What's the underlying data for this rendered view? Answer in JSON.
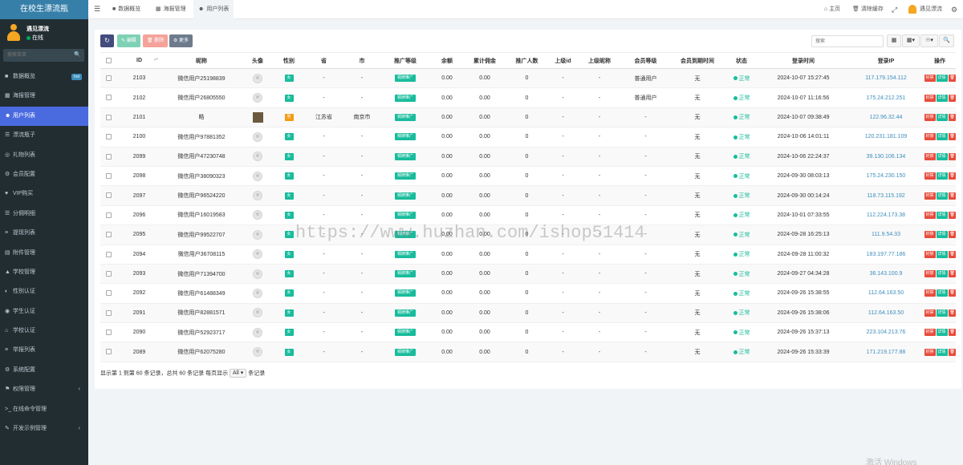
{
  "app": {
    "title": "在校生漂流瓶"
  },
  "user": {
    "name": "遇见漂流",
    "status": "在线"
  },
  "search": {
    "placeholder": "搜索菜单"
  },
  "menu": [
    {
      "label": "数据概览",
      "icon": "dashboard-icon",
      "badge": "hot"
    },
    {
      "label": "海报管理",
      "icon": "poster-icon"
    },
    {
      "label": "用户列表",
      "icon": "users-icon",
      "active": true
    },
    {
      "label": "漂流瓶子",
      "icon": "list-icon"
    },
    {
      "label": "礼物列表",
      "icon": "gift-icon"
    },
    {
      "label": "会员配置",
      "icon": "gear-icon"
    },
    {
      "label": "VIP购买",
      "icon": "vip-icon"
    },
    {
      "label": "分佣明细",
      "icon": "commission-icon"
    },
    {
      "label": "提现列表",
      "icon": "withdraw-icon"
    },
    {
      "label": "附件管理",
      "icon": "attachment-icon"
    },
    {
      "label": "学校管理",
      "icon": "school-icon"
    },
    {
      "label": "性别认证",
      "icon": "gender-icon"
    },
    {
      "label": "学生认证",
      "icon": "student-icon"
    },
    {
      "label": "学校认证",
      "icon": "bank-icon"
    },
    {
      "label": "举报列表",
      "icon": "report-icon"
    },
    {
      "label": "系统配置",
      "icon": "system-icon"
    },
    {
      "label": "权限管理",
      "icon": "permission-icon",
      "expandable": true
    },
    {
      "label": "在线命令管理",
      "icon": "terminal-icon"
    },
    {
      "label": "开发示例管理",
      "icon": "dev-icon",
      "expandable": true
    }
  ],
  "tabs": [
    {
      "label": "数据概览",
      "icon": "dashboard-icon"
    },
    {
      "label": "海报管理",
      "icon": "poster-icon"
    },
    {
      "label": "用户列表",
      "icon": "users-icon",
      "active": true
    }
  ],
  "topbar": {
    "home": "主页",
    "clear_cache": "清除缓存",
    "username": "遇见漂流"
  },
  "toolbar": {
    "edit": "编辑",
    "delete": "删除",
    "more": "更多",
    "search_placeholder": "搜索"
  },
  "table": {
    "columns": [
      "ID",
      "昵称",
      "头像",
      "性别",
      "省",
      "市",
      "推广等级",
      "余额",
      "累计佣金",
      "推广人数",
      "上级id",
      "上级昵称",
      "会员等级",
      "会员到期时间",
      "状态",
      "登录时间",
      "登录IP",
      "操作"
    ],
    "rows": [
      {
        "id": "2103",
        "nickname": "微信用户25198839",
        "avatar": "default",
        "gender": "女",
        "province": "-",
        "city": "-",
        "promo": "铜牌推广",
        "balance": "0.00",
        "commission": "0.00",
        "invites": "0",
        "parent_id": "-",
        "parent_name": "-",
        "member_level": "普通用户",
        "expire": "无",
        "status": "正常",
        "login_time": "2024-10-07 15:27:45",
        "ip": "117.179.154.112"
      },
      {
        "id": "2102",
        "nickname": "微信用户26805550",
        "avatar": "default",
        "gender": "女",
        "province": "-",
        "city": "-",
        "promo": "铜牌推广",
        "balance": "0.00",
        "commission": "0.00",
        "invites": "0",
        "parent_id": "-",
        "parent_name": "-",
        "member_level": "普通用户",
        "expire": "无",
        "status": "正常",
        "login_time": "2024-10-07 11:16:56",
        "ip": "175.24.212.251"
      },
      {
        "id": "2101",
        "nickname": "皓",
        "avatar": "photo",
        "gender": "男",
        "province": "江苏省",
        "city": "南京市",
        "promo": "铜牌推广",
        "balance": "0.00",
        "commission": "0.00",
        "invites": "0",
        "parent_id": "-",
        "parent_name": "-",
        "member_level": "-",
        "expire": "无",
        "status": "正常",
        "login_time": "2024-10-07 09:38:49",
        "ip": "122.96.32.44"
      },
      {
        "id": "2100",
        "nickname": "微信用户97881352",
        "avatar": "default",
        "gender": "女",
        "province": "-",
        "city": "-",
        "promo": "铜牌推广",
        "balance": "0.00",
        "commission": "0.00",
        "invites": "0",
        "parent_id": "-",
        "parent_name": "-",
        "member_level": "-",
        "expire": "无",
        "status": "正常",
        "login_time": "2024-10-06 14:01:11",
        "ip": "120.231.181.109"
      },
      {
        "id": "2099",
        "nickname": "微信用户47230748",
        "avatar": "default",
        "gender": "女",
        "province": "-",
        "city": "-",
        "promo": "铜牌推广",
        "balance": "0.00",
        "commission": "0.00",
        "invites": "0",
        "parent_id": "-",
        "parent_name": "-",
        "member_level": "-",
        "expire": "无",
        "status": "正常",
        "login_time": "2024-10-06 22:24:37",
        "ip": "39.130.106.134"
      },
      {
        "id": "2098",
        "nickname": "微信用户38090323",
        "avatar": "default",
        "gender": "女",
        "province": "-",
        "city": "-",
        "promo": "铜牌推广",
        "balance": "0.00",
        "commission": "0.00",
        "invites": "0",
        "parent_id": "-",
        "parent_name": "-",
        "member_level": "-",
        "expire": "无",
        "status": "正常",
        "login_time": "2024-09-30 08:03:13",
        "ip": "175.24.230.150"
      },
      {
        "id": "2097",
        "nickname": "微信用户96524220",
        "avatar": "default",
        "gender": "女",
        "province": "-",
        "city": "-",
        "promo": "铜牌推广",
        "balance": "0.00",
        "commission": "0.00",
        "invites": "0",
        "parent_id": "-",
        "parent_name": "-",
        "member_level": "-",
        "expire": "无",
        "status": "正常",
        "login_time": "2024-09-30 00:14:24",
        "ip": "118.73.115.192"
      },
      {
        "id": "2096",
        "nickname": "微信用户16019583",
        "avatar": "default",
        "gender": "女",
        "province": "-",
        "city": "-",
        "promo": "铜牌推广",
        "balance": "0.00",
        "commission": "0.00",
        "invites": "0",
        "parent_id": "-",
        "parent_name": "-",
        "member_level": "-",
        "expire": "无",
        "status": "正常",
        "login_time": "2024-10-01 07:33:55",
        "ip": "112.224.173.38"
      },
      {
        "id": "2095",
        "nickname": "微信用户99522707",
        "avatar": "default",
        "gender": "女",
        "province": "-",
        "city": "-",
        "promo": "铜牌推广",
        "balance": "0.00",
        "commission": "0.00",
        "invites": "0",
        "parent_id": "-",
        "parent_name": "-",
        "member_level": "-",
        "expire": "无",
        "status": "正常",
        "login_time": "2024-09-28 16:25:13",
        "ip": "111.9.54.33"
      },
      {
        "id": "2094",
        "nickname": "微信用户36708115",
        "avatar": "default",
        "gender": "女",
        "province": "-",
        "city": "-",
        "promo": "铜牌推广",
        "balance": "0.00",
        "commission": "0.00",
        "invites": "0",
        "parent_id": "-",
        "parent_name": "-",
        "member_level": "-",
        "expire": "无",
        "status": "正常",
        "login_time": "2024-09-28 11:00:32",
        "ip": "183.197.77.186"
      },
      {
        "id": "2093",
        "nickname": "微信用户71394700",
        "avatar": "default",
        "gender": "女",
        "province": "-",
        "city": "-",
        "promo": "铜牌推广",
        "balance": "0.00",
        "commission": "0.00",
        "invites": "0",
        "parent_id": "-",
        "parent_name": "-",
        "member_level": "-",
        "expire": "无",
        "status": "正常",
        "login_time": "2024-09-27 04:34:28",
        "ip": "36.143.100.9"
      },
      {
        "id": "2092",
        "nickname": "微信用户61488349",
        "avatar": "default",
        "gender": "女",
        "province": "-",
        "city": "-",
        "promo": "铜牌推广",
        "balance": "0.00",
        "commission": "0.00",
        "invites": "0",
        "parent_id": "-",
        "parent_name": "-",
        "member_level": "-",
        "expire": "无",
        "status": "正常",
        "login_time": "2024-09-26 15:38:55",
        "ip": "112.64.163.50"
      },
      {
        "id": "2091",
        "nickname": "微信用户82881571",
        "avatar": "default",
        "gender": "女",
        "province": "-",
        "city": "-",
        "promo": "铜牌推广",
        "balance": "0.00",
        "commission": "0.00",
        "invites": "0",
        "parent_id": "-",
        "parent_name": "-",
        "member_level": "-",
        "expire": "无",
        "status": "正常",
        "login_time": "2024-09-26 15:38:06",
        "ip": "112.64.163.50"
      },
      {
        "id": "2090",
        "nickname": "微信用户52923717",
        "avatar": "default",
        "gender": "女",
        "province": "-",
        "city": "-",
        "promo": "铜牌推广",
        "balance": "0.00",
        "commission": "0.00",
        "invites": "0",
        "parent_id": "-",
        "parent_name": "-",
        "member_level": "-",
        "expire": "无",
        "status": "正常",
        "login_time": "2024-09-26 15:37:13",
        "ip": "223.104.213.76"
      },
      {
        "id": "2089",
        "nickname": "微信用户62075280",
        "avatar": "default",
        "gender": "女",
        "province": "-",
        "city": "-",
        "promo": "铜牌推广",
        "balance": "0.00",
        "commission": "0.00",
        "invites": "0",
        "parent_id": "-",
        "parent_name": "-",
        "member_level": "-",
        "expire": "无",
        "status": "正常",
        "login_time": "2024-09-26 15:33:39",
        "ip": "171.219.177.88"
      }
    ],
    "row_actions": {
      "ban": "封禁",
      "detail": "详情"
    }
  },
  "pagination": {
    "summary": "显示第 1 到第 60 条记录，总共 60 条记录 每页显示",
    "page_size": "All",
    "suffix": "条记录"
  },
  "watermark": "https://www.huzhan.com/ishop51414",
  "windows_activate": "激活 Windows",
  "colors": {
    "sidebar": "#222d32",
    "logo": "#367fa9",
    "active_menu": "#4a6be0",
    "success": "#18bc9c",
    "danger": "#e74c3c",
    "link": "#3c8dbc"
  }
}
